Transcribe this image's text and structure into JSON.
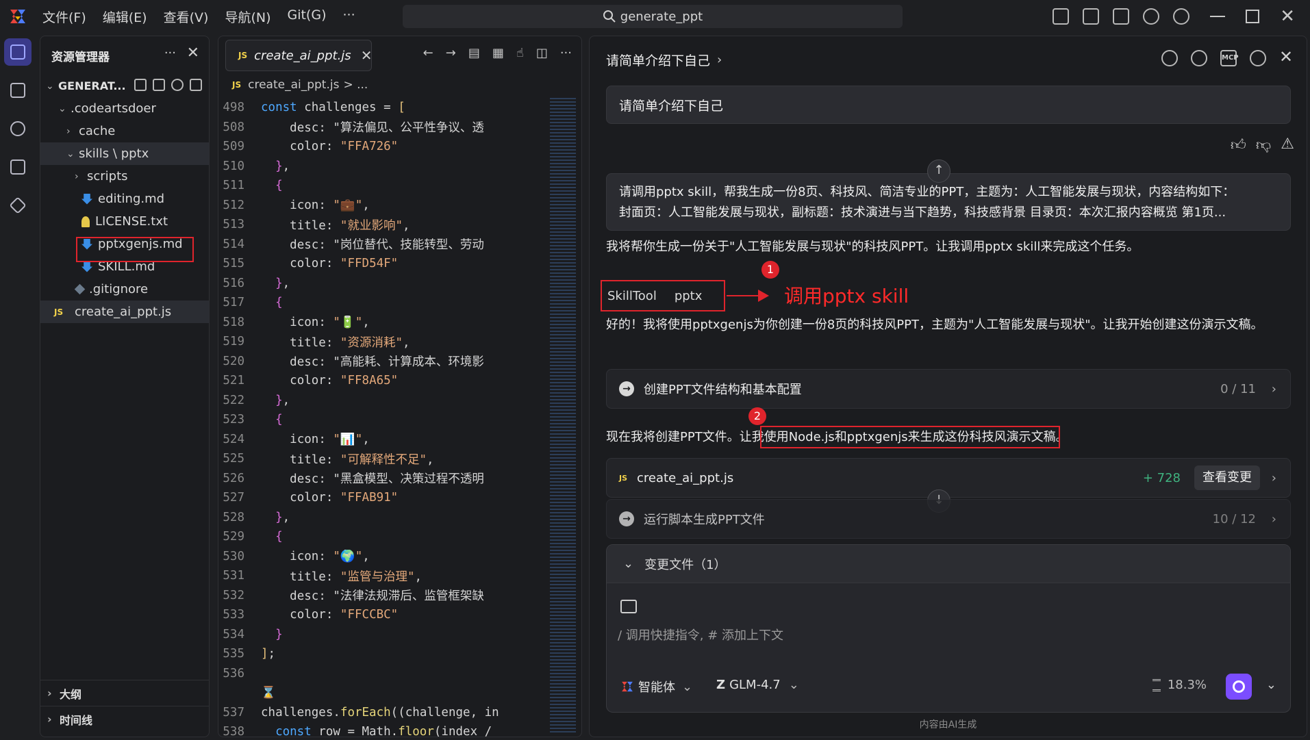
{
  "titlebar": {
    "menus": [
      "文件(F)",
      "编辑(E)",
      "查看(V)",
      "导航(N)",
      "Git(G)",
      "···"
    ],
    "search_text": "generate_ppt"
  },
  "explorer": {
    "title": "资源管理器",
    "dots": "···",
    "close": "✕",
    "root": "GENERAT...",
    "items": [
      {
        "label": ".codeartsdoer",
        "chev": "⌄",
        "icon": "none"
      },
      {
        "label": "cache",
        "chev": "›",
        "icon": "none"
      },
      {
        "label": "skills \\ pptx",
        "chev": "⌄",
        "icon": "none"
      },
      {
        "label": "scripts",
        "chev": "›",
        "icon": "none"
      },
      {
        "label": "editing.md",
        "chev": "",
        "icon": "markdown-icon"
      },
      {
        "label": "LICENSE.txt",
        "chev": "",
        "icon": "license-icon"
      },
      {
        "label": "pptxgenjs.md",
        "chev": "",
        "icon": "markdown-icon"
      },
      {
        "label": "SKILL.md",
        "chev": "",
        "icon": "markdown-icon"
      },
      {
        "label": ".gitignore",
        "chev": "",
        "icon": "git-icon"
      },
      {
        "label": "create_ai_ppt.js",
        "chev": "",
        "icon": "js-icon"
      }
    ],
    "outline": "大纲",
    "timeline": "时间线"
  },
  "editor": {
    "tab_name": "create_ai_ppt.js",
    "tab_icon": "JS",
    "breadcrumb_file": "create_ai_ppt.js",
    "breadcrumb_rest": "> ...",
    "lines": [
      {
        "n": "498",
        "t": "const challenges = ["
      },
      {
        "n": "508",
        "t": "    desc: \"算法偏见、公平性争议、透"
      },
      {
        "n": "509",
        "t": "    color: \"FFA726\""
      },
      {
        "n": "510",
        "t": "  },"
      },
      {
        "n": "511",
        "t": "  {"
      },
      {
        "n": "512",
        "t": "    icon: \"💼\","
      },
      {
        "n": "513",
        "t": "    title: \"就业影响\","
      },
      {
        "n": "514",
        "t": "    desc: \"岗位替代、技能转型、劳动"
      },
      {
        "n": "515",
        "t": "    color: \"FFD54F\""
      },
      {
        "n": "516",
        "t": "  },"
      },
      {
        "n": "517",
        "t": "  {"
      },
      {
        "n": "518",
        "t": "    icon: \"🔋\","
      },
      {
        "n": "519",
        "t": "    title: \"资源消耗\","
      },
      {
        "n": "520",
        "t": "    desc: \"高能耗、计算成本、环境影"
      },
      {
        "n": "521",
        "t": "    color: \"FF8A65\""
      },
      {
        "n": "522",
        "t": "  },"
      },
      {
        "n": "523",
        "t": "  {"
      },
      {
        "n": "524",
        "t": "    icon: \"📊\","
      },
      {
        "n": "525",
        "t": "    title: \"可解释性不足\","
      },
      {
        "n": "526",
        "t": "    desc: \"黑盒模型、决策过程不透明"
      },
      {
        "n": "527",
        "t": "    color: \"FFAB91\""
      },
      {
        "n": "528",
        "t": "  },"
      },
      {
        "n": "529",
        "t": "  {"
      },
      {
        "n": "530",
        "t": "    icon: \"🌍\","
      },
      {
        "n": "531",
        "t": "    title: \"监管与治理\","
      },
      {
        "n": "532",
        "t": "    desc: \"法律法规滞后、监管框架缺"
      },
      {
        "n": "533",
        "t": "    color: \"FFCCBC\""
      },
      {
        "n": "534",
        "t": "  }"
      },
      {
        "n": "535",
        "t": "];"
      },
      {
        "n": "536",
        "t": ""
      },
      {
        "n": "",
        "t": "⌛"
      },
      {
        "n": "537",
        "t": "challenges.forEach((challenge, in"
      },
      {
        "n": "538",
        "t": "  const row = Math.floor(index /"
      }
    ]
  },
  "ai": {
    "title": "请简单介绍下自己",
    "user_q1": "请简单介绍下自己",
    "user_q2_line1": "请调用pptx skill，帮我生成一份8页、科技风、简洁专业的PPT，主题为：人工智能发展与现状，内容结构如下：",
    "user_q2_line2": "封面页：人工智能发展与现状，副标题：技术演进与当下趋势，科技感背景 目录页：本次汇报内容概览 第1页...",
    "reply1": "我将帮你生成一份关于\"人工智能发展与现状\"的科技风PPT。让我调用pptx skill来完成这个任务。",
    "skill_tool": "SkillTool",
    "skill_name": "pptx",
    "annot1_num": "1",
    "annot1_text": "调用pptx skill",
    "reply2": "好的！我将使用pptxgenjs为你创建一份8页的科技风PPT，主题为\"人工智能发展与现状\"。让我开始创建这份演示文稿。",
    "step1_label": "创建PPT文件结构和基本配置",
    "step1_count": "0 / 11",
    "annot2_num": "2",
    "reply3_a": "现在我将创建PPT文件。让我",
    "reply3_b": "使用Node.js和pptxgenjs来生成这份科技风演示文稿",
    "reply3_c": "。",
    "file_icon": "JS",
    "file_name": "create_ai_ppt.js",
    "file_added": "+ 728",
    "view_changes": "查看变更",
    "step2_label": "运行脚本生成PPT文件",
    "step2_count": "10 / 12",
    "changed_files": "变更文件（1）",
    "input_placeholder": "/ 调用快捷指令, # 添加上下文",
    "agent_label": "智能体",
    "model_label": "GLM-4.7",
    "usage": "18.3%",
    "footer": "内容由AI生成"
  },
  "colors": {
    "accent": "#7b4dff",
    "annotation_red": "#e0242c",
    "added_green": "#3fb27f"
  }
}
